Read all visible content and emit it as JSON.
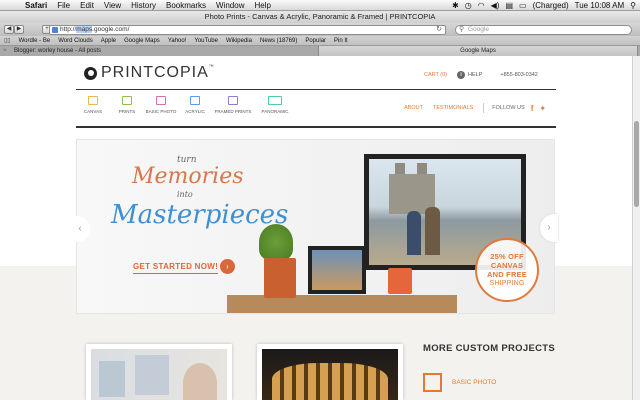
{
  "menubar": {
    "app": "Safari",
    "items": [
      "File",
      "Edit",
      "View",
      "History",
      "Bookmarks",
      "Window",
      "Help"
    ],
    "battery": "(Charged)",
    "clock": "Tue 10:08 AM"
  },
  "window": {
    "title": "Photo Prints - Canvas & Acrylic, Panoramic & Framed | PRINTCOPIA"
  },
  "toolbar": {
    "url_prefix": "http://",
    "url_selected": "maps",
    "url_rest": ".google.com/",
    "search_placeholder": "Google"
  },
  "bookmarks": [
    "Wordle - Be",
    "Word Clouds",
    "Apple",
    "Google Maps",
    "Yahoo!",
    "YouTube",
    "Wikipedia",
    "News (18769)",
    "Popular",
    "Pin It"
  ],
  "tabs": [
    {
      "label": "Blogger: worley house - All posts"
    },
    {
      "label": "Google Maps"
    }
  ],
  "site": {
    "logo_text": "PRINTCOPIA",
    "logo_tm": "™",
    "cart": "CART (0)",
    "help": "HELP",
    "phone": "+855-803-0342",
    "categories": [
      "CANVAS",
      "PRINTS",
      "BASIC PHOTO",
      "ACRYLIC",
      "FRAMED PRINTS",
      "PANORAMIC"
    ],
    "category_colors": [
      "#e9b949",
      "#8cc152",
      "#d770ad",
      "#5d9cec",
      "#967adc",
      "#48cfad"
    ],
    "about": "ABOUT",
    "testimonials": "TESTIMONIALS",
    "follow_us": "FOLLOW US",
    "hero": {
      "turn": "turn",
      "memories": "Memories",
      "into": "into",
      "masterpieces": "Masterpieces",
      "cta": "GET STARTED NOW!",
      "badge_pct": "25% OFF",
      "badge_line2": "CANVAS",
      "badge_line3": "AND FREE",
      "badge_line4": "SHIPPING"
    },
    "more_title": "MORE CUSTOM PROJECTS",
    "basic_photo": "BASIC PHOTO"
  }
}
